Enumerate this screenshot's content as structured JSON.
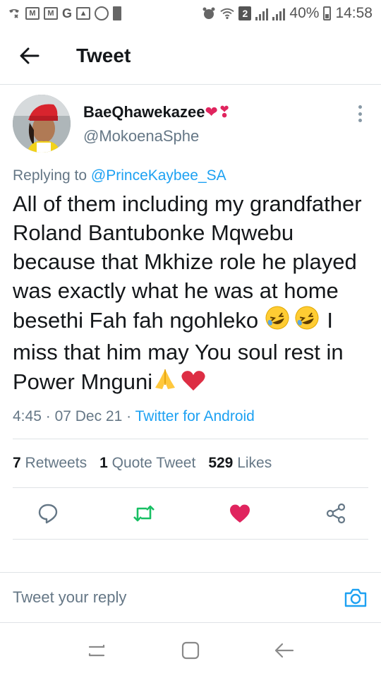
{
  "status_bar": {
    "icons_left": [
      "missed-call-icon",
      "gmail-icon",
      "gmail-icon",
      "google-icon",
      "gallery-icon",
      "settings-icon",
      "sd-card-icon"
    ],
    "sim_badge": "2",
    "battery": "40%",
    "time": "14:58"
  },
  "header": {
    "back_icon": "arrow-left-icon",
    "title": "Tweet"
  },
  "tweet": {
    "author": {
      "display_name": "BaeQhawekazee",
      "name_emoji": "❤❣",
      "handle": "@MokoenaSphe"
    },
    "replying_prefix": "Replying to",
    "replying_to": "@PrinceKaybee_SA",
    "text_part1": "All of them including my grandfather Roland Bantubonke Mqwebu because that Mkhize role he played was exactly what he was at home besethi Fah fah ngohleko",
    "emoji_laugh": "🤣🤣",
    "text_part2": " I miss that him may You soul rest in Power Mnguni",
    "emoji_end": "🙏❤",
    "time": "4:45",
    "date": "07 Dec 21",
    "separator": "·",
    "source": "Twitter for Android"
  },
  "stats": {
    "retweets_count": "7",
    "retweets_label": "Retweets",
    "quotes_count": "1",
    "quotes_label": "Quote Tweet",
    "likes_count": "529",
    "likes_label": "Likes"
  },
  "actions": [
    "reply-icon",
    "retweet-icon",
    "like-icon",
    "share-icon"
  ],
  "reply_bar": {
    "placeholder": "Tweet your reply"
  },
  "colors": {
    "accent": "#1da1f2",
    "retweet": "#17bf63",
    "like": "#e0245e",
    "secondary_text": "#657786"
  }
}
